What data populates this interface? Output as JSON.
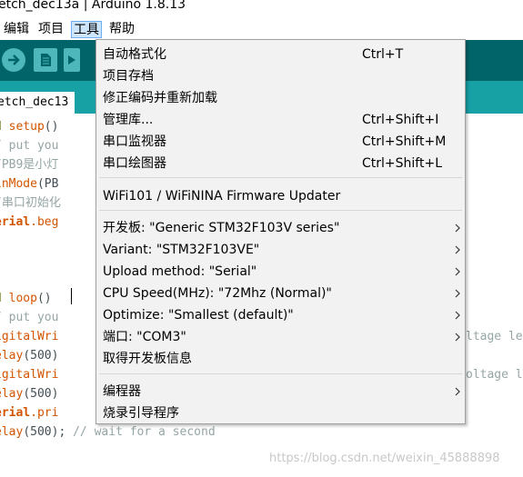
{
  "window": {
    "title": "etch_dec13a | Arduino 1.8.13"
  },
  "menubar": {
    "items": [
      {
        "label": "编辑"
      },
      {
        "label": "项目"
      },
      {
        "label": "工具"
      },
      {
        "label": "帮助"
      }
    ],
    "active": "工具"
  },
  "toolbar": {
    "icons": [
      "upload-arrow-icon",
      "new-sketch-icon",
      "open-icon"
    ]
  },
  "tab": {
    "label": "etch_dec13"
  },
  "editor": {
    "lines": [
      {
        "a": "d ",
        "b": "setup",
        "c": "()"
      },
      {
        "a": "/ put you"
      },
      {
        "a": "/PB9是小灯"
      },
      {
        "a": "inMode",
        "b": "(PB"
      },
      {
        "a": "/串口初始化"
      },
      {
        "a": "erial",
        "b": ".beg"
      },
      {
        "a": ""
      },
      {
        "a": ""
      },
      {
        "a": "d ",
        "b": "loop",
        "c": "()"
      },
      {
        "a": "/ put you"
      },
      {
        "a": "igitalWri",
        "tail": "ltage le"
      },
      {
        "a": "elay",
        "b": "(500)"
      },
      {
        "a": "igitalWri",
        "tail": "oltage l"
      },
      {
        "a": "elay",
        "b": "(500)"
      },
      {
        "a": "erial",
        "b": ".pri"
      },
      {
        "a": "elay",
        "b": "(500); ",
        "c": "// wait for a second"
      }
    ]
  },
  "tools_menu": {
    "items": [
      {
        "label": "自动格式化",
        "shortcut": "Ctrl+T"
      },
      {
        "label": "项目存档",
        "shortcut": ""
      },
      {
        "label": "修正编码并重新加载",
        "shortcut": ""
      },
      {
        "label": "管理库...",
        "shortcut": "Ctrl+Shift+I"
      },
      {
        "label": "串口监视器",
        "shortcut": "Ctrl+Shift+M"
      },
      {
        "label": "串口绘图器",
        "shortcut": "Ctrl+Shift+L"
      },
      {
        "label": "WiFi101 / WiFiNINA Firmware Updater",
        "shortcut": ""
      },
      {
        "label": "开发板: \"Generic STM32F103V series\"",
        "submenu": true
      },
      {
        "label": "Variant: \"STM32F103VE\"",
        "submenu": true
      },
      {
        "label": "Upload method: \"Serial\"",
        "submenu": true
      },
      {
        "label": "CPU Speed(MHz): \"72Mhz (Normal)\"",
        "submenu": true
      },
      {
        "label": "Optimize: \"Smallest (default)\"",
        "submenu": true
      },
      {
        "label": "端口: \"COM3\"",
        "submenu": true
      },
      {
        "label": "取得开发板信息",
        "submenu": false
      },
      {
        "label": "编程器",
        "submenu": true
      },
      {
        "label": "烧录引导程序",
        "submenu": false
      }
    ]
  },
  "watermark": "https://blog.csdn.net/weixin_45888898",
  "colors": {
    "toolbar": "#006468",
    "tabbar": "#17a1a5",
    "button": "#4db7bb",
    "menu_bg": "#f2f2f2",
    "keyword": "#5e6d03",
    "function": "#d35400",
    "comment": "#95a5a6"
  }
}
